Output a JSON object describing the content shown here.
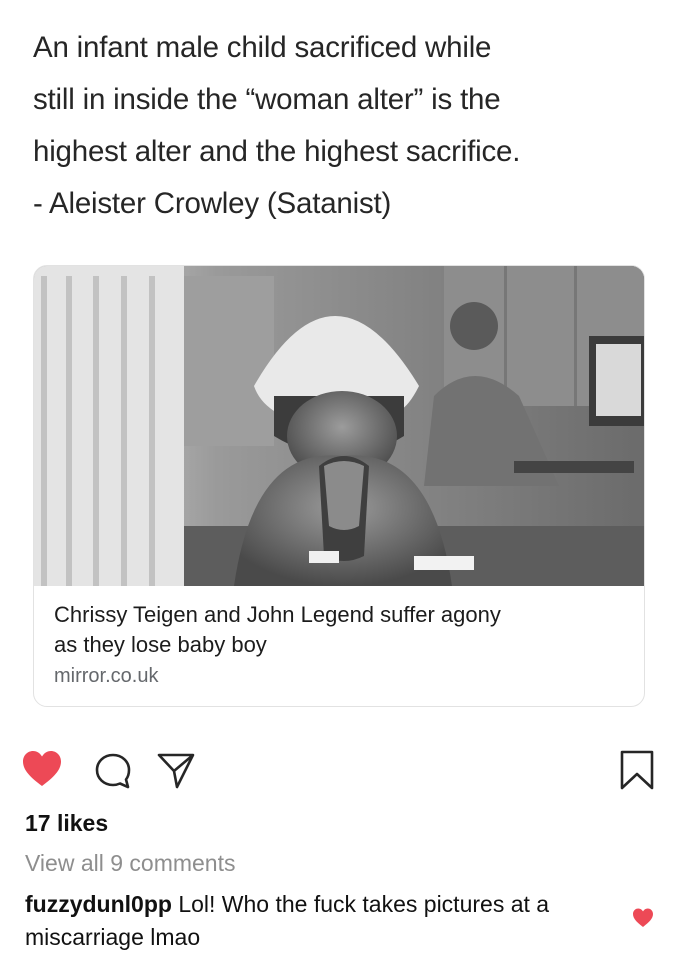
{
  "quote": {
    "lines": [
      "An infant male child sacrificed while",
      "still in inside the “woman alter” is the",
      "highest alter and the highest sacrifice.",
      "- Aleister Crowley (Satanist)"
    ]
  },
  "link_card": {
    "title_lines": [
      "Chrissy Teigen and John Legend suffer agony",
      "as they lose baby boy"
    ],
    "source": "mirror.co.uk",
    "image": "black-and-white hospital photo of a woman in a hair net crying with clasped hands, nurse at a monitor behind her"
  },
  "actions": {
    "like_icon": "heart-filled-icon",
    "comment_icon": "comment-bubble-icon",
    "share_icon": "paper-plane-icon",
    "save_icon": "bookmark-icon",
    "like_color": "#ed4956"
  },
  "likes": "17 likes",
  "view_all_comments": "View all 9 comments",
  "comment": {
    "username": "fuzzydunl0pp",
    "text": " Lol! Who the fuck takes pictures at a miscarriage lmao",
    "like_icon": "heart-filled-icon"
  }
}
